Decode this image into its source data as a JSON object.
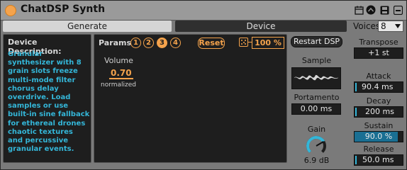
{
  "title": "ChatDSP Synth",
  "tabs": {
    "generate": "Generate",
    "device": "Device"
  },
  "voices": {
    "label": "Voices",
    "value": "8"
  },
  "description": {
    "title": "Device Description:",
    "body": "Granular synthesizer with 8 grain slots freeze multi-mode filter chorus delay overdrive. Load samples or use built-in sine fallback for ethereal drones chaotic textures and percussive granular events."
  },
  "params": {
    "label": "Params",
    "pages": [
      "1",
      "2",
      "3",
      "4"
    ],
    "active_page": "3",
    "reset": "Reset",
    "percent": "100 %",
    "volume": {
      "label": "Volume",
      "value": "0.70",
      "note": "normalized"
    }
  },
  "restart": "Restart DSP",
  "sample": {
    "label": "Sample"
  },
  "portamento": {
    "label": "Portamento",
    "value": "0.00 ms"
  },
  "gain": {
    "label": "Gain",
    "value": "6.9 dB",
    "level": 0.72
  },
  "transpose": {
    "label": "Transpose",
    "value": "+1 st"
  },
  "attack": {
    "label": "Attack",
    "value": "90.4 ms"
  },
  "decay": {
    "label": "Decay",
    "value": "200 ms"
  },
  "sustain": {
    "label": "Sustain",
    "value": "90.0 %",
    "level": 0.9
  },
  "release": {
    "label": "Release",
    "value": "50.0 ms"
  },
  "colors": {
    "accent": "#f5a34c",
    "blue": "#34b6d8"
  }
}
